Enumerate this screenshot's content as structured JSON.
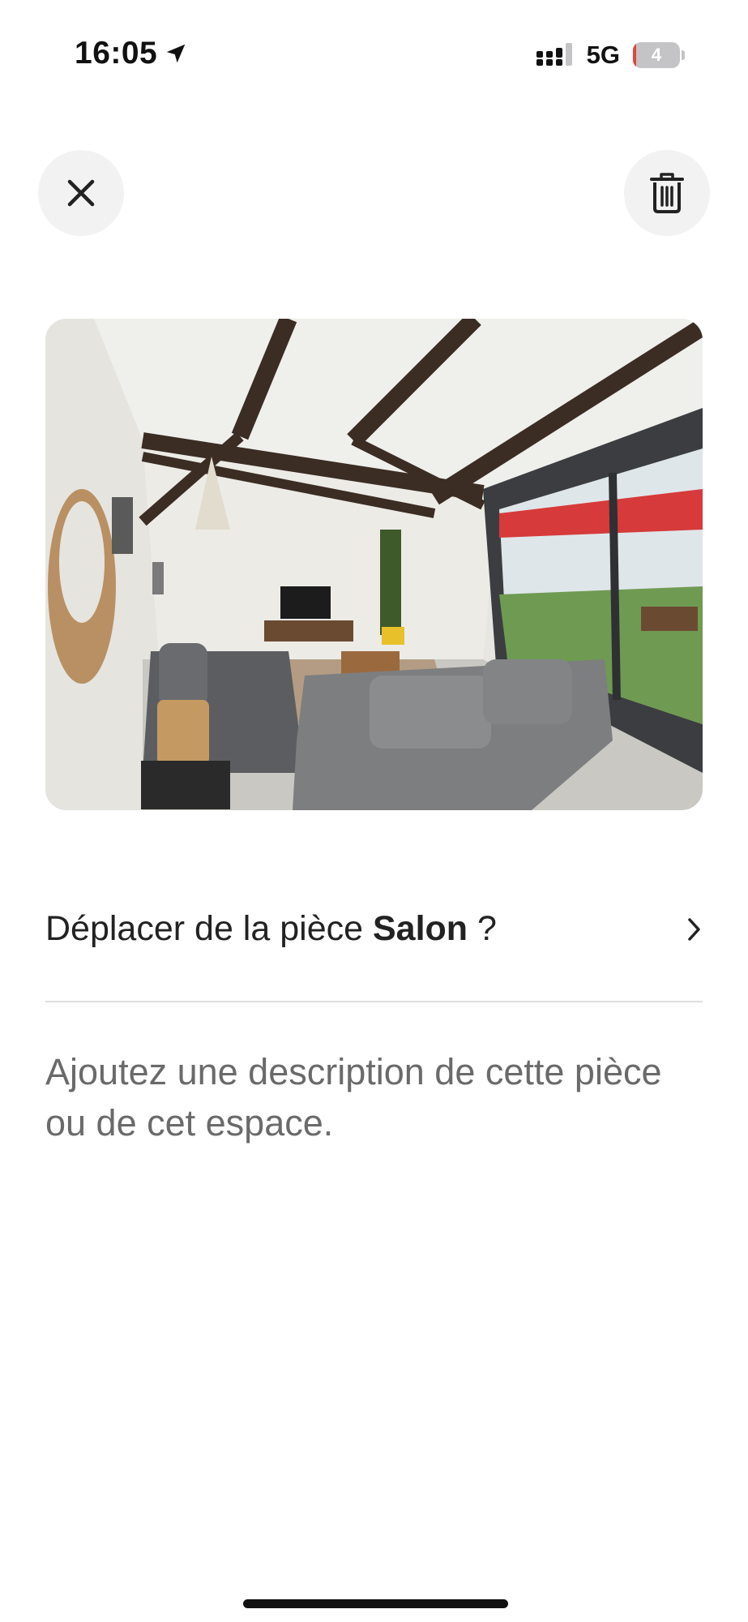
{
  "status_bar": {
    "time": "16:05",
    "network": "5G",
    "battery_level": "4",
    "icons": [
      "location-arrow-icon",
      "signal-icon",
      "battery-icon"
    ]
  },
  "toolbar": {
    "close_icon": "close-icon",
    "delete_icon": "trash-icon"
  },
  "photo": {
    "subject": "room-photo"
  },
  "move": {
    "prefix": "Déplacer de la pièce",
    "room": "Salon",
    "suffix": "?",
    "icon": "chevron-right-icon"
  },
  "description": {
    "value": "",
    "placeholder": "Ajoutez une description de cette pièce ou de cet espace."
  },
  "colors": {
    "text": "#222222",
    "muted": "#6a6a6a",
    "button_bg": "#f2f2f2",
    "divider": "#dddddd",
    "battery_low": "#e5453b"
  }
}
